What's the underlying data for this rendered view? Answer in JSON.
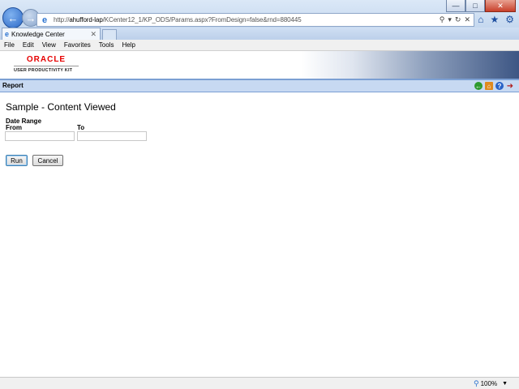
{
  "browser": {
    "url_prefix": "http://",
    "url_host": "ahufford-lap",
    "url_path": "/KCenter12_1/KP_ODS/Params.aspx?FromDesign=false&rnd=880445",
    "tab_title": "Knowledge Center",
    "menu": [
      "File",
      "Edit",
      "View",
      "Favorites",
      "Tools",
      "Help"
    ],
    "zoom": "100%"
  },
  "header": {
    "logo_name": "ORACLE",
    "logo_tagline": "USER PRODUCTIVITY KIT"
  },
  "report_bar": {
    "title": "Report"
  },
  "form": {
    "heading": "Sample - Content Viewed",
    "date_range_label": "Date Range",
    "from_label": "From",
    "to_label": "To",
    "from_value": "",
    "to_value": "",
    "run_label": "Run",
    "cancel_label": "Cancel"
  },
  "colors": {
    "oracle_red": "#e60000",
    "report_bar": "#c7d9f2"
  }
}
